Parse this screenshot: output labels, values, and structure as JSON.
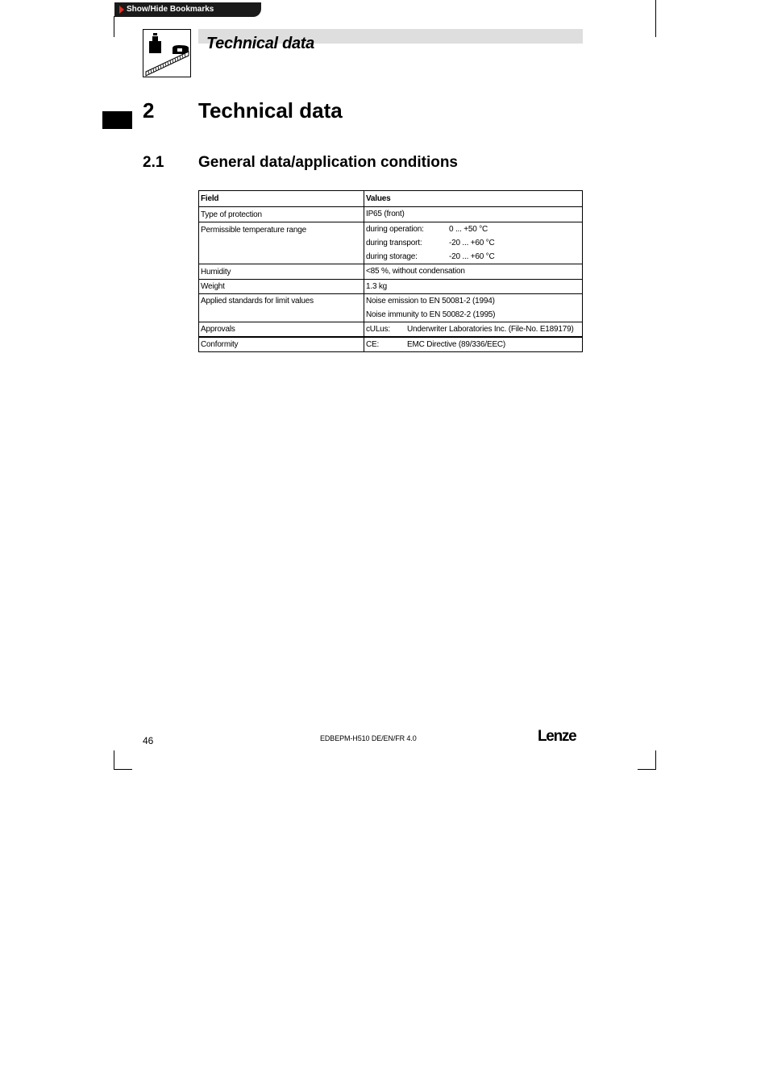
{
  "bookmarks": {
    "label": "Show/Hide Bookmarks"
  },
  "header": {
    "title": "Technical data"
  },
  "chapter": {
    "number": "2",
    "title": "Technical data"
  },
  "section": {
    "number": "2.1",
    "title": "General data/application conditions"
  },
  "table": {
    "headers": [
      "Field",
      "Values"
    ],
    "rows": {
      "protection": {
        "field": "Type of protection",
        "value": "IP65 (front)"
      },
      "temperature": {
        "field": "Permissible temperature range",
        "operation_label": "during operation:",
        "operation_value": "0 ... +50 °C",
        "transport_label": "during transport:",
        "transport_value": "-20 ... +60 °C",
        "storage_label": "during storage:",
        "storage_value": "-20 ... +60 °C"
      },
      "humidity": {
        "field": "Humidity",
        "value": "<85 %, without condensation"
      },
      "weight": {
        "field": "Weight",
        "value": "1.3 kg"
      },
      "standards": {
        "field": "Applied standards for limit values",
        "line1": "Noise emission to EN 50081-2 (1994)",
        "line2": "Noise immunity to EN 50082-2 (1995)"
      },
      "approvals": {
        "field": "Approvals",
        "key": "cULus:",
        "value": "Underwriter Laboratories Inc. (File-No. E189179)"
      },
      "conformity": {
        "field": "Conformity",
        "key": "CE:",
        "value": "EMC Directive (89/336/EEC)"
      }
    }
  },
  "footer": {
    "page_number": "46",
    "doc_id": "EDBEPM-H510 DE/EN/FR 4.0",
    "logo": "Lenze"
  },
  "icons": {
    "bookmark_arrow": "triangle-right-icon",
    "header_icon": "weight-ruler-icon"
  }
}
